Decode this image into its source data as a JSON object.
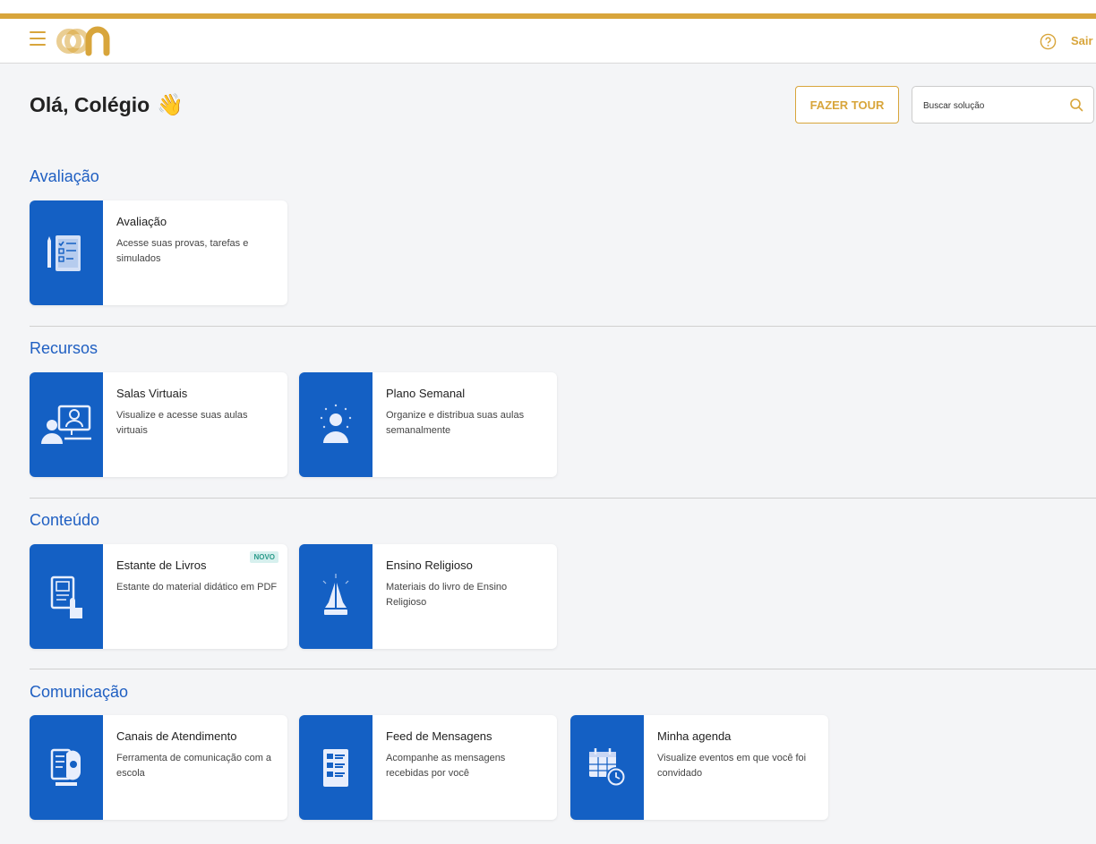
{
  "header": {
    "logo_text": "on",
    "logout_label": "Sair"
  },
  "greeting": {
    "text": "Olá, Colégio",
    "emoji": "👋"
  },
  "tour_button": "FAZER TOUR",
  "search": {
    "placeholder": "Buscar solução",
    "value": ""
  },
  "sections": [
    {
      "title": "Avaliação",
      "cards": [
        {
          "title": "Avaliação",
          "description": "Acesse suas provas, tarefas e simulados",
          "icon": "assessment-icon"
        }
      ]
    },
    {
      "title": "Recursos",
      "cards": [
        {
          "title": "Salas Virtuais",
          "description": "Visualize e acesse suas aulas virtuais",
          "icon": "virtual-classroom-icon"
        },
        {
          "title": "Plano Semanal",
          "description": "Organize e distribua suas aulas semanalmente",
          "icon": "weekly-plan-icon"
        }
      ]
    },
    {
      "title": "Conteúdo",
      "cards": [
        {
          "title": "Estante de Livros",
          "description": "Estante do material didático em PDF",
          "icon": "bookshelf-icon",
          "badge": "NOVO"
        },
        {
          "title": "Ensino Religioso",
          "description": "Materiais do livro de Ensino Religioso",
          "icon": "praying-hands-icon"
        }
      ]
    },
    {
      "title": "Comunicação",
      "cards": [
        {
          "title": "Canais de Atendimento",
          "description": "Ferramenta de comunicação com a escola",
          "icon": "support-channel-icon"
        },
        {
          "title": "Feed de Mensagens",
          "description": "Acompanhe as mensagens recebidas por você",
          "icon": "message-feed-icon"
        },
        {
          "title": "Minha agenda",
          "description": "Visualize eventos em que você foi convidado",
          "icon": "calendar-clock-icon"
        }
      ]
    }
  ],
  "colors": {
    "gold": "#d8a53b",
    "blue_tile": "#1460c4",
    "section_title": "#1f5fc2"
  }
}
